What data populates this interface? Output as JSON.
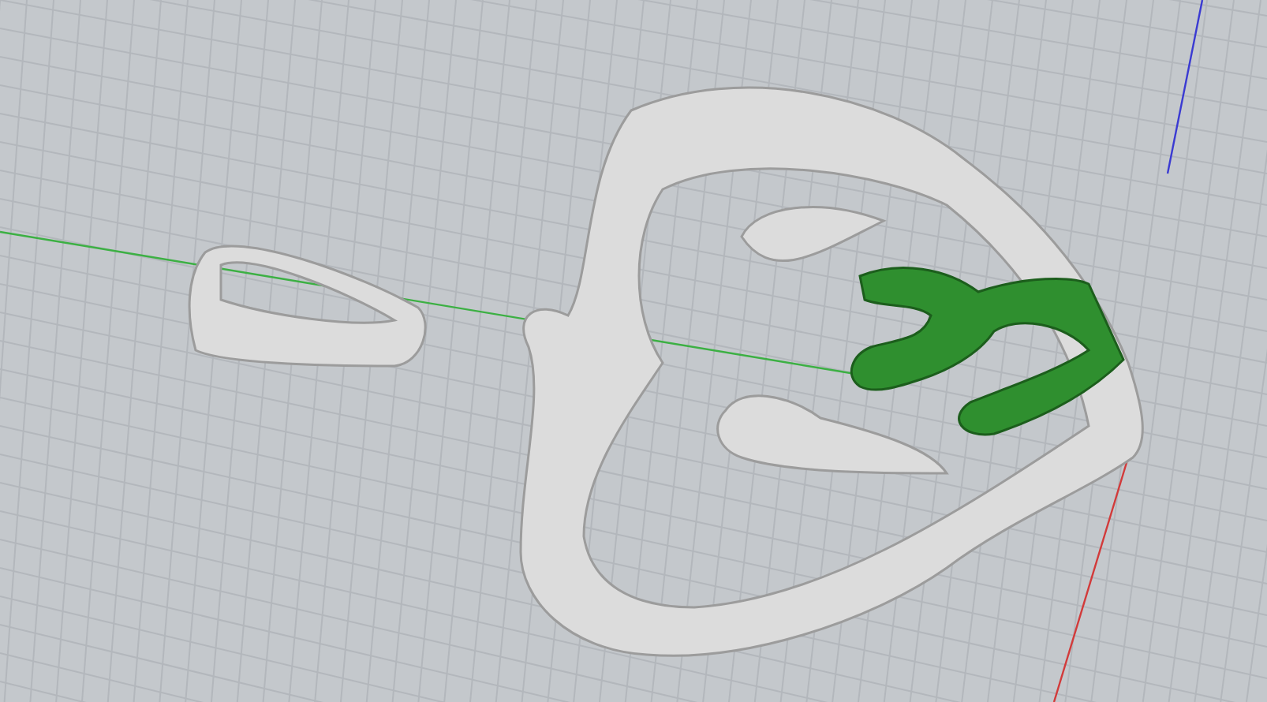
{
  "viewport": {
    "grid": true,
    "axes": true
  },
  "objects": [
    {
      "kind": "bail",
      "selected": false
    },
    {
      "kind": "heart-frame",
      "selected": false
    },
    {
      "kind": "inner-swirl",
      "selected": true
    }
  ]
}
